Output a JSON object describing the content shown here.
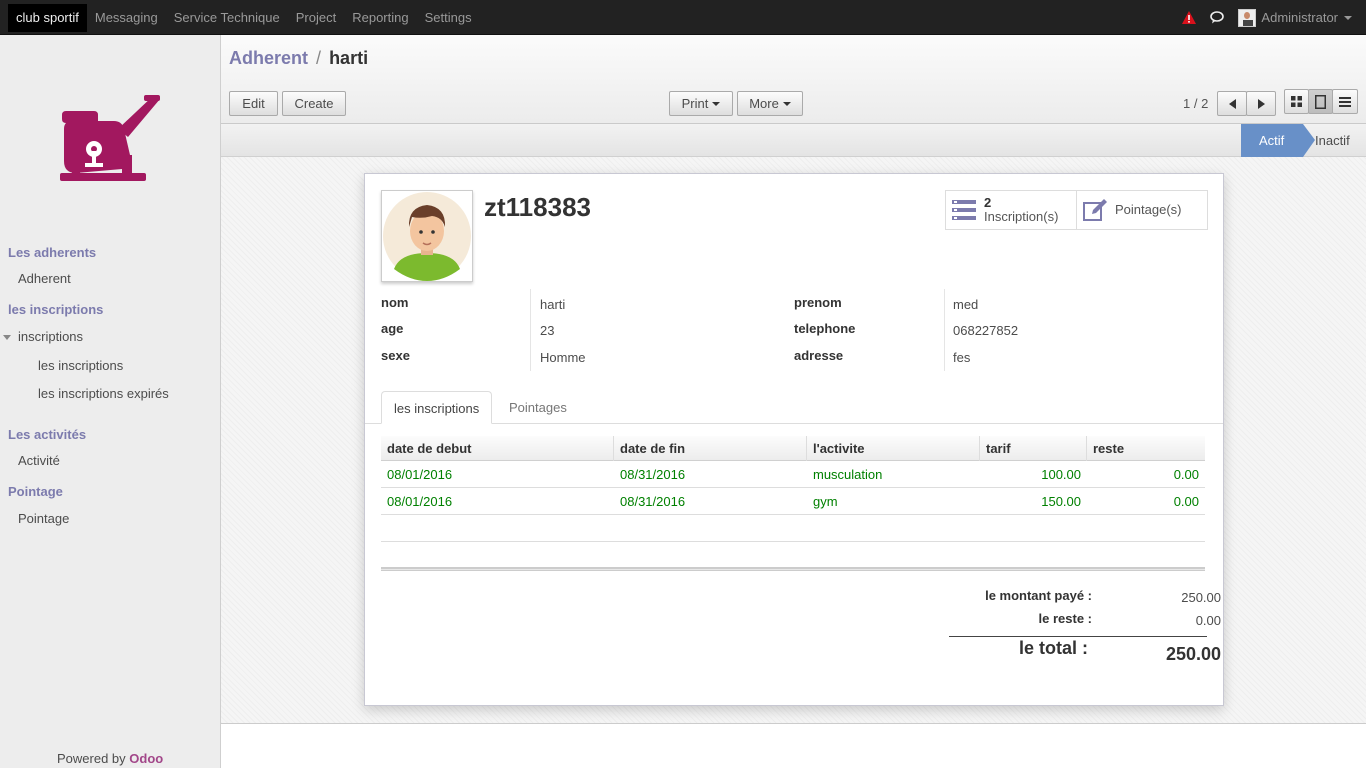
{
  "topbar": {
    "menu": [
      "club sportif",
      "Messaging",
      "Service Technique",
      "Project",
      "Reporting",
      "Settings"
    ],
    "user": "Administrator"
  },
  "sidebar": {
    "sections": [
      {
        "title": "Les adherents",
        "items": [
          "Adherent"
        ]
      },
      {
        "title": "les inscriptions",
        "items": [
          "inscriptions",
          "les inscriptions",
          "les inscriptions expirés"
        ]
      },
      {
        "title": "Les activités",
        "items": [
          "Activité"
        ]
      },
      {
        "title": "Pointage",
        "items": [
          "Pointage"
        ]
      }
    ],
    "powered_by": "Powered by",
    "powered_brand": "Odoo",
    "brand_color": "#a24689"
  },
  "control": {
    "breadcrumb_parent": "Adherent",
    "breadcrumb_sep": "/",
    "breadcrumb_current": "harti",
    "edit_label": "Edit",
    "create_label": "Create",
    "print_label": "Print",
    "more_label": "More",
    "pager": "1 / 2"
  },
  "status": {
    "active_stage": "Actif",
    "inactive_stage": "Inactif",
    "accent": "#6890c8"
  },
  "record": {
    "name": "zt118383",
    "stat_inscriptions_count": "2",
    "stat_inscriptions_label": "Inscription(s)",
    "stat_pointage_label": "Pointage(s)",
    "fields": {
      "nom_label": "nom",
      "nom": "harti",
      "age_label": "age",
      "age": "23",
      "sexe_label": "sexe",
      "sexe": "Homme",
      "prenom_label": "prenom",
      "prenom": "med",
      "telephone_label": "telephone",
      "telephone": "068227852",
      "adresse_label": "adresse",
      "adresse": "fes"
    }
  },
  "tabs": [
    "les inscriptions",
    "Pointages"
  ],
  "grid": {
    "headers": [
      "date de debut",
      "date de fin",
      "l'activite",
      "tarif",
      "reste"
    ],
    "rows": [
      {
        "debut": "08/01/2016",
        "fin": "08/31/2016",
        "activite": "musculation",
        "tarif": "100.00",
        "reste": "0.00"
      },
      {
        "debut": "08/01/2016",
        "fin": "08/31/2016",
        "activite": "gym",
        "tarif": "150.00",
        "reste": "0.00"
      }
    ]
  },
  "totals": {
    "paye_label": "le montant payé :",
    "paye": "250.00",
    "reste_label": "le reste :",
    "reste": "0.00",
    "total_label": "le total :",
    "total": "250.00"
  }
}
